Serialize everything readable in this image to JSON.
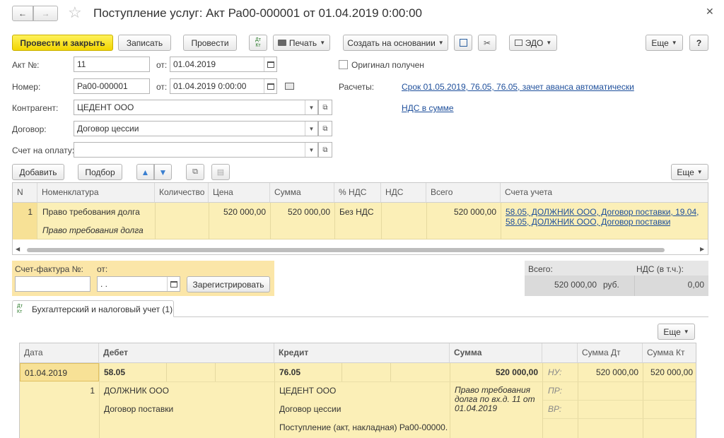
{
  "window": {
    "title": "Поступление услуг: Акт Ра00-000001 от 01.04.2019 0:00:00"
  },
  "toolbar": {
    "post_close": "Провести и закрыть",
    "save": "Записать",
    "post": "Провести",
    "dtkt": "Дт Кт",
    "print": "Печать",
    "create_based": "Создать на основании",
    "edo": "ЭДО",
    "more": "Еще",
    "help": "?"
  },
  "form": {
    "act_no_label": "Акт №:",
    "act_no": "11",
    "from_label": "от:",
    "act_date": "01.04.2019",
    "original_label": "Оригинал получен",
    "number_label": "Номер:",
    "number": "Ра00-000001",
    "from_label2": "от:",
    "doc_datetime": "01.04.2019  0:00:00",
    "settlements_label": "Расчеты:",
    "settlements_link": "Срок 01.05.2019, 76.05, 76.05, зачет аванса автоматически",
    "counterparty_label": "Контрагент:",
    "counterparty": "ЦЕДЕНТ ООО",
    "vat_link": "НДС в сумме",
    "contract_label": "Договор:",
    "contract": "Договор цессии",
    "invoice_label": "Счет на оплату:",
    "invoice": ""
  },
  "goods_toolbar": {
    "add": "Добавить",
    "pick": "Подбор",
    "more": "Еще"
  },
  "goods_table": {
    "headers": [
      "N",
      "Номенклатура",
      "Количество",
      "Цена",
      "Сумма",
      "% НДС",
      "НДС",
      "Всего",
      "Счета учета"
    ],
    "row": {
      "n": "1",
      "item": "Право требования долга",
      "item_sub": "Право требования долга",
      "qty": "",
      "price": "520 000,00",
      "sum": "520 000,00",
      "vat_rate": "Без НДС",
      "vat": "",
      "total": "520 000,00",
      "accounts1": "58.05, ДОЛЖНИК ООО, Договор поставки, 19.04,",
      "accounts2": "58.05, ДОЛЖНИК ООО, Договор поставки"
    }
  },
  "invoice_block": {
    "label": "Счет-фактура №:",
    "from_label": "от:",
    "number": "",
    "date": " .  .",
    "register": "Зарегистрировать"
  },
  "totals": {
    "total_label": "Всего:",
    "vat_label": "НДС (в т.ч.):",
    "total": "520 000,00",
    "currency": "руб.",
    "vat": "0,00"
  },
  "tab": {
    "icon_text": "Дт Кт",
    "label": "Бухгалтерский и налоговый учет (1)"
  },
  "postings_toolbar": {
    "more": "Еще"
  },
  "postings_table": {
    "headers": [
      "Дата",
      "Дебет",
      "Кредит",
      "Сумма",
      "",
      "Сумма Дт",
      "Сумма Кт"
    ],
    "row": {
      "date": "01.04.2019",
      "n": "1",
      "debit": "58.05",
      "debit_sub1": "ДОЛЖНИК ООО",
      "debit_sub2": "Договор поставки",
      "credit": "76.05",
      "credit_sub1": "ЦЕДЕНТ ООО",
      "credit_sub2": "Договор цессии",
      "credit_sub3": "Поступление (акт, накладная) Ра00-00000...",
      "sum": "520 000,00",
      "content": "Право требования долга по вх.д. 11 от 01.04.2019",
      "nu": "НУ:",
      "pr": "ПР:",
      "vr": "ВР:",
      "sum_dt": "520 000,00",
      "sum_kt": "520 000,00"
    }
  }
}
